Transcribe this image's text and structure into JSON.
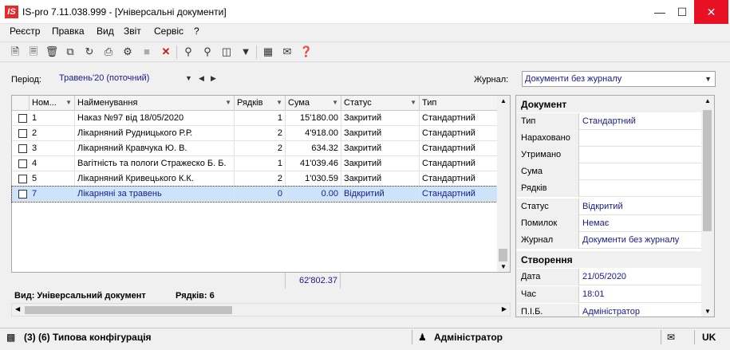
{
  "window": {
    "title": "IS-pro 7.11.038.999 - [Універсальні документи]",
    "logo": "IS"
  },
  "menu": [
    "Реєстр",
    "Правка",
    "Вид",
    "Звіт",
    "Сервіс",
    "?"
  ],
  "filters": {
    "period_label": "Період:",
    "period_value": "Травень'20 (поточний)",
    "journal_label": "Журнал:",
    "journal_value": "Документи без журналу"
  },
  "grid": {
    "columns": [
      "Ном...",
      "Найменування",
      "Рядків",
      "Сума",
      "Статус",
      "Тип"
    ],
    "rows": [
      {
        "num": "1",
        "name": "Наказ №97 від 18/05/2020",
        "rows": "1",
        "sum": "15'180.00",
        "status": "Закритий",
        "type": "Стандартний"
      },
      {
        "num": "2",
        "name": "Лікарняний Рудницького Р.Р.",
        "rows": "2",
        "sum": "4'918.00",
        "status": "Закритий",
        "type": "Стандартний"
      },
      {
        "num": "3",
        "name": "Лікарняний Кравчука Ю. В.",
        "rows": "2",
        "sum": "634.32",
        "status": "Закритий",
        "type": "Стандартний"
      },
      {
        "num": "4",
        "name": "Вагітність та пологи Стражеско Б. Б.",
        "rows": "1",
        "sum": "41'039.46",
        "status": "Закритий",
        "type": "Стандартний"
      },
      {
        "num": "5",
        "name": "Лікарняний Кривецького К.К.",
        "rows": "2",
        "sum": "1'030.59",
        "status": "Закритий",
        "type": "Стандартний"
      },
      {
        "num": "7",
        "name": "Лікарняні за травень",
        "rows": "0",
        "sum": "0.00",
        "status": "Відкритий",
        "type": "Стандартний"
      }
    ],
    "total_sum": "62'802.37"
  },
  "info": {
    "view": "Вид: Універсальний документ",
    "rows_count": "Рядків: 6"
  },
  "panel": {
    "section_document": "Документ",
    "doc_fields": [
      {
        "k": "Тип",
        "v": "Стандартний"
      },
      {
        "k": "Нараховано",
        "v": ""
      },
      {
        "k": "Утримано",
        "v": ""
      },
      {
        "k": "Сума",
        "v": ""
      },
      {
        "k": "Рядків",
        "v": ""
      },
      {
        "k": "Статус",
        "v": "Відкритий"
      },
      {
        "k": "Помилок",
        "v": "Немає"
      },
      {
        "k": "Журнал",
        "v": "Документи без журналу"
      }
    ],
    "section_created": "Створення",
    "created_fields": [
      {
        "k": "Дата",
        "v": "21/05/2020"
      },
      {
        "k": "Час",
        "v": "18:01"
      },
      {
        "k": "П.І.Б.",
        "v": "Адміністратор"
      }
    ]
  },
  "statusbar": {
    "config": "(3) (6) Типова конфігурація",
    "user": "Адміністратор",
    "lang": "UK"
  }
}
